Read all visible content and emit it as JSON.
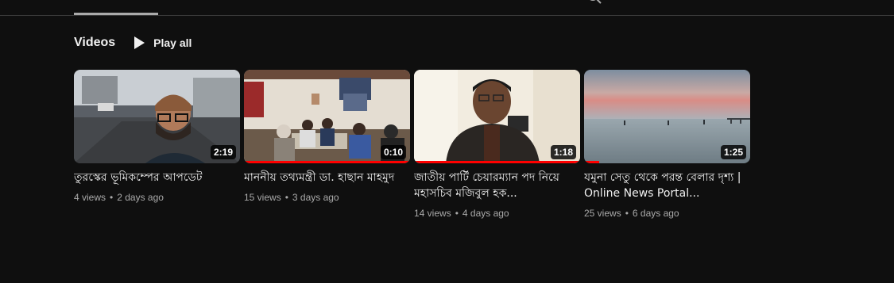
{
  "shelf": {
    "title": "Videos",
    "play_all_label": "Play all"
  },
  "videos": [
    {
      "title": "তুরস্কের ভূমিকম্পের আপডেট",
      "duration": "2:19",
      "views": "4 views",
      "age": "2 days ago",
      "watched_fraction": 0
    },
    {
      "title": "মাননীয় তথ্যমন্ত্রী ডা. হাছান মাহমুদ",
      "duration": "0:10",
      "views": "15 views",
      "age": "3 days ago",
      "watched_fraction": 1.0
    },
    {
      "title": "জাতীয় পার্টি চেয়ারম্যান পদ নিয়ে মহাসচিব মজিবুল হক...",
      "duration": "1:18",
      "views": "14 views",
      "age": "4 days ago",
      "watched_fraction": 1.0
    },
    {
      "title": "যমুনা সেতু থেকে পরন্ত বেলার দৃশ্য | Online News Portal...",
      "duration": "1:25",
      "views": "25 views",
      "age": "6 days ago",
      "watched_fraction": 0.09
    }
  ],
  "colors": {
    "background": "#0f0f0f",
    "progress": "#ff0000",
    "meta_text": "#aaaaaa"
  }
}
